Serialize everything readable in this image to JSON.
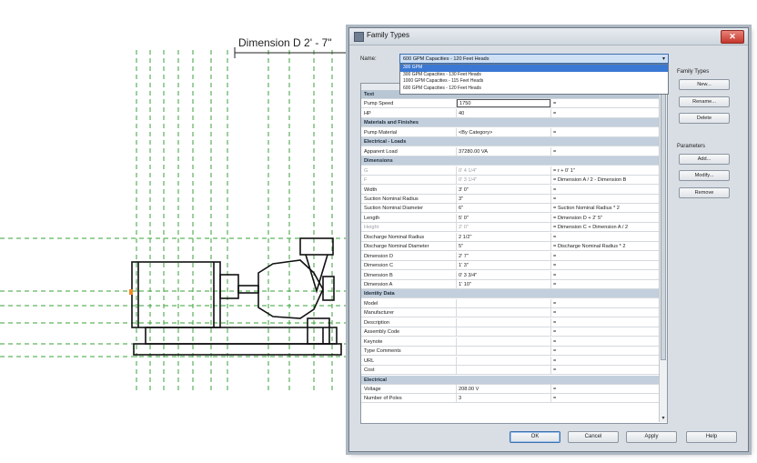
{
  "drawing": {
    "dimension_label": "Dimension D 2' - 7\""
  },
  "dialog": {
    "title": "Family Types",
    "close_glyph": "✕",
    "name_label": "Name:",
    "selected_type": "600 GPM Capacities - 120 Feet Heads",
    "dropdown_options": [
      "300 GPM",
      "300 GPM Capacities - 130 Feet Heads",
      "1000 GPM Capacities - 115 Feet Heads",
      "600 GPM Capacities - 120 Feet Heads"
    ],
    "dropdown_selected_index": 0,
    "parameters": [
      {
        "kind": "section",
        "label": "Text"
      },
      {
        "kind": "row",
        "name": "Pump Speed",
        "value": "1750",
        "formula": "=",
        "editing": true
      },
      {
        "kind": "row",
        "name": "HP",
        "value": "40",
        "formula": "="
      },
      {
        "kind": "section",
        "label": "Materials and Finishes"
      },
      {
        "kind": "row",
        "name": "Pump Material",
        "value": "<By Category>",
        "formula": "="
      },
      {
        "kind": "section",
        "label": "Electrical - Loads"
      },
      {
        "kind": "row",
        "name": "Apparent Load",
        "value": "37280.00 VA",
        "formula": "="
      },
      {
        "kind": "section",
        "label": "Dimensions"
      },
      {
        "kind": "row",
        "name": "G",
        "value": "0' 4 1/4\"",
        "formula": "= r + 0' 1\"",
        "disabled": true
      },
      {
        "kind": "row",
        "name": "F",
        "value": "0' 3 1/4\"",
        "formula": "= Dimension A / 2 - Dimension B",
        "disabled": true
      },
      {
        "kind": "row",
        "name": "Width",
        "value": "3' 0\"",
        "formula": "="
      },
      {
        "kind": "row",
        "name": "Suction Nominal Radius",
        "value": "3\"",
        "formula": "="
      },
      {
        "kind": "row",
        "name": "Suction Nominal Diameter",
        "value": "6\"",
        "formula": "= Suction Nominal Radius * 2"
      },
      {
        "kind": "row",
        "name": "Length",
        "value": "5' 0\"",
        "formula": "= Dimension D + 2' 5\""
      },
      {
        "kind": "row",
        "name": "Height",
        "value": "2' 0\"",
        "formula": "= Dimension C + Dimension A / 2",
        "disabled": true
      },
      {
        "kind": "row",
        "name": "Discharge Nominal Radius",
        "value": "2 1/2\"",
        "formula": "="
      },
      {
        "kind": "row",
        "name": "Discharge Nominal Diameter",
        "value": "5\"",
        "formula": "= Discharge Nominal Radius * 2"
      },
      {
        "kind": "row",
        "name": "Dimension D",
        "value": "2' 7\"",
        "formula": "="
      },
      {
        "kind": "row",
        "name": "Dimension C",
        "value": "1' 3\"",
        "formula": "="
      },
      {
        "kind": "row",
        "name": "Dimension B",
        "value": "0' 3 3/4\"",
        "formula": "="
      },
      {
        "kind": "row",
        "name": "Dimension A",
        "value": "1' 10\"",
        "formula": "="
      },
      {
        "kind": "section",
        "label": "Identity Data"
      },
      {
        "kind": "row",
        "name": "Model",
        "value": "",
        "formula": "="
      },
      {
        "kind": "row",
        "name": "Manufacturer",
        "value": "",
        "formula": "="
      },
      {
        "kind": "row",
        "name": "Description",
        "value": "",
        "formula": "="
      },
      {
        "kind": "row",
        "name": "Assembly Code",
        "value": "",
        "formula": "="
      },
      {
        "kind": "row",
        "name": "Keynote",
        "value": "",
        "formula": "="
      },
      {
        "kind": "row",
        "name": "Type Comments",
        "value": "",
        "formula": "="
      },
      {
        "kind": "row",
        "name": "URL",
        "value": "",
        "formula": "="
      },
      {
        "kind": "row",
        "name": "Cost",
        "value": "",
        "formula": "="
      },
      {
        "kind": "section",
        "label": "Electrical"
      },
      {
        "kind": "row",
        "name": "Voltage",
        "value": "208.00 V",
        "formula": "="
      },
      {
        "kind": "row",
        "name": "Number of Poles",
        "value": "3",
        "formula": "="
      }
    ],
    "section_chevron": "¥",
    "family_types_label": "Family Types",
    "family_types_buttons": [
      "New...",
      "Rename...",
      "Delete"
    ],
    "parameters_label": "Parameters",
    "parameters_buttons": [
      "Add...",
      "Modify...",
      "Remove"
    ],
    "bottom_buttons": [
      "OK",
      "Cancel",
      "Apply",
      "Help"
    ]
  },
  "colors": {
    "dialog_bg": "#d9dee4",
    "section_bg": "#c3cfdc",
    "dropdown_highlight": "#3a78d4",
    "drawing_lines": "#2f9a2f"
  }
}
